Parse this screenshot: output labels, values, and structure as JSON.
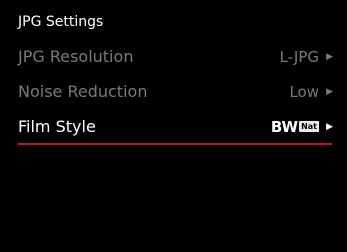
{
  "header": {
    "title": "JPG Settings"
  },
  "items": [
    {
      "label": "JPG Resolution",
      "value": "L-JPG",
      "enabled": false
    },
    {
      "label": "Noise Reduction",
      "value": "Low",
      "enabled": false
    },
    {
      "label": "Film Style",
      "value": "BW",
      "badge": "Nat",
      "enabled": true,
      "selected": true
    }
  ],
  "colors": {
    "background": "#000000",
    "active_text": "#ffffff",
    "inactive_text": "#7a7a7a",
    "selection_underline": "#c8102e"
  },
  "icons": {
    "chevron": "chevron-right-icon"
  }
}
